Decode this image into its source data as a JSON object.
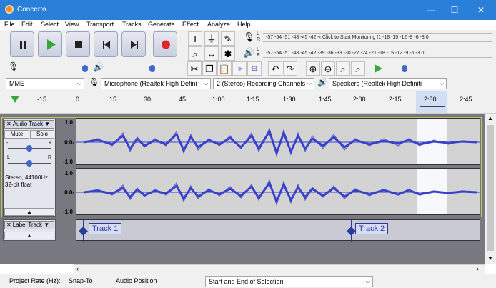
{
  "window": {
    "title": "Concerto",
    "minimize": "—",
    "maximize": "☐",
    "close": "✕"
  },
  "menu": [
    "File",
    "Edit",
    "Select",
    "View",
    "Transport",
    "Tracks",
    "Generate",
    "Effect",
    "Analyze",
    "Help"
  ],
  "meters": {
    "record_channel_labels": [
      "L",
      "R"
    ],
    "record_scale": "-57 -54 -51 -48 -45 -42 -‹ Click to Start Monitoring !1 -18 -15 -12  -9  -6  -3  0",
    "playback_channel_labels": [
      "L",
      "R"
    ],
    "playback_scale": "-57 -54 -51 -48 -45 -42 -39 -36 -33 -30 -27 -24 -21 -18 -15 -12  -9  -6  -3  0"
  },
  "devices": {
    "host": "MME",
    "input": "Microphone (Realtek High Defini",
    "channels": "2 (Stereo) Recording Channels",
    "output": "Speakers (Realtek High Definiti"
  },
  "ruler_ticks": [
    "-15",
    "0",
    "15",
    "30",
    "45",
    "1:00",
    "1:15",
    "1:30",
    "1:45",
    "2:00",
    "2:15",
    "2:30",
    "2:45"
  ],
  "audio_track": {
    "name": "Audio Track",
    "mute": "Mute",
    "solo": "Solo",
    "pan_left": "L",
    "pan_right": "R",
    "info_line1": "Stereo, 44100Hz",
    "info_line2": "32-bit float",
    "scale_top": "1.0",
    "scale_mid": "0.0-",
    "scale_bottom": "-1.0",
    "scale_top_2": "1.0",
    "scale_mid_2": "0.0-",
    "scale_bottom_2": "-1.0"
  },
  "label_track": {
    "name": "Label Track",
    "labels": [
      "Track 1",
      "Track 2"
    ]
  },
  "status": {
    "project_rate_label": "Project Rate (Hz):",
    "snap_to_label": "Snap-To",
    "audio_position_label": "Audio Position",
    "selection_mode": "Start and End of Selection"
  },
  "icons": {
    "play_color": "#38a838",
    "record_color": "#e0262b",
    "wave_color": "#3b42c9"
  }
}
